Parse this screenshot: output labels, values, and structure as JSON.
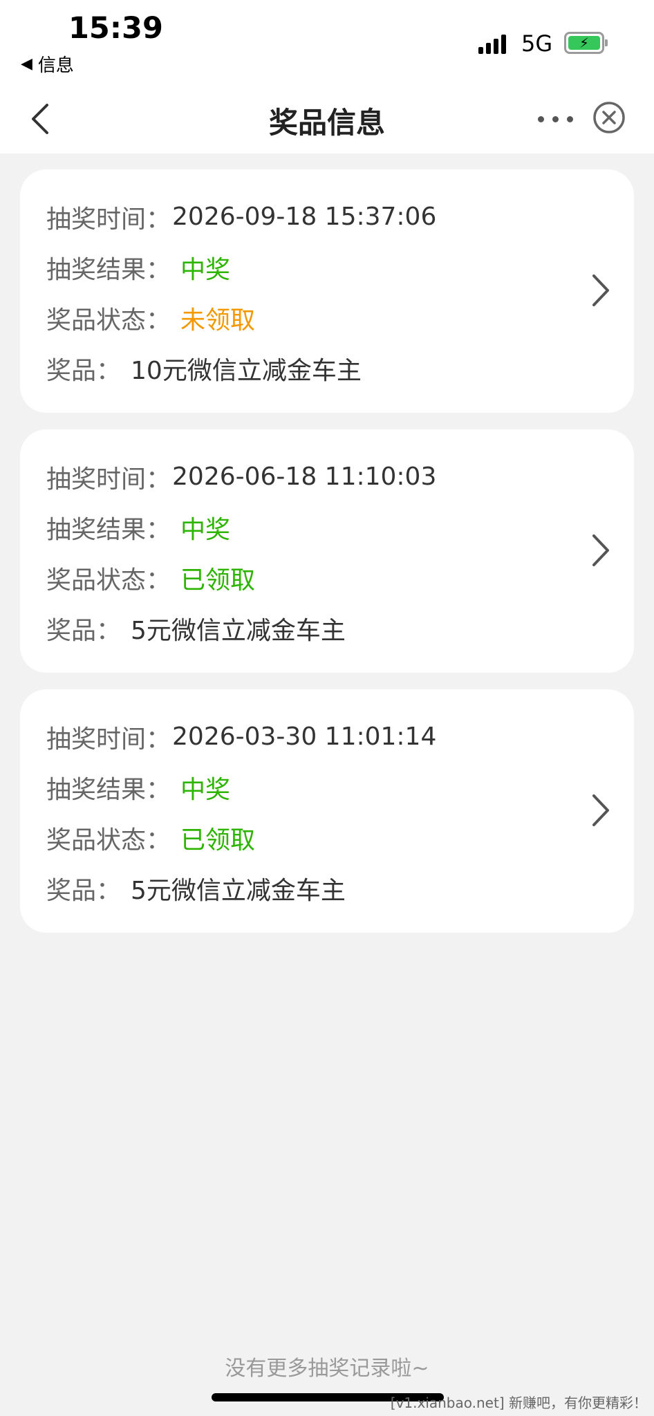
{
  "status": {
    "time": "15:39",
    "back_app": "信息",
    "network": "5G"
  },
  "nav": {
    "title": "奖品信息"
  },
  "records": [
    {
      "time_label": "抽奖时间：",
      "time": "2026-09-18 15:37:06",
      "result_label": "抽奖结果：",
      "result": "中奖",
      "status_label": "奖品状态：",
      "status": "未领取",
      "prize_label": "奖品：",
      "prize": "10元微信立减金车主"
    },
    {
      "time_label": "抽奖时间：",
      "time": "2026-06-18 11:10:03",
      "result_label": "抽奖结果：",
      "result": "中奖",
      "status_label": "奖品状态：",
      "status": "已领取",
      "prize_label": "奖品：",
      "prize": "5元微信立减金车主"
    },
    {
      "time_label": "抽奖时间：",
      "time": "2026-03-30 11:01:14",
      "result_label": "抽奖结果：",
      "result": "中奖",
      "status_label": "奖品状态：",
      "status": "已领取",
      "prize_label": "奖品：",
      "prize": "5元微信立减金车主"
    }
  ],
  "footer": {
    "no_more": "没有更多抽奖记录啦~",
    "watermark": "[v1.xianbao.net] 新赚吧，有你更精彩！"
  },
  "colors": {
    "success_green": "#2db400",
    "pending_orange": "#f39800",
    "battery_green": "#35c759"
  },
  "icons": {
    "back": "chevron-left-icon",
    "more": "more-dots-icon",
    "close": "close-circle-icon",
    "card_arrow": "chevron-right-icon"
  }
}
